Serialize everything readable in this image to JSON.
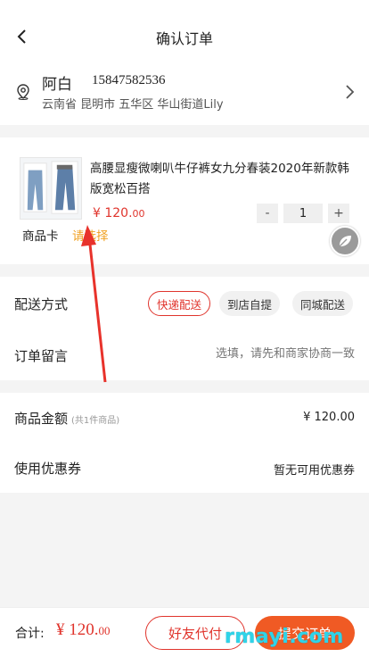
{
  "header": {
    "title": "确认订单"
  },
  "address": {
    "name": "阿白",
    "phone": "15847582536",
    "detail": "云南省 昆明市 五华区 华山街道Lily"
  },
  "product": {
    "title": "高腰显瘦微喇叭牛仔裤女九分春装2020年新款韩版宽松百搭",
    "price_main": "¥ 120.",
    "price_cents": "00",
    "qty_minus": "-",
    "qty_value": "1",
    "qty_plus": "+",
    "card_label": "商品卡",
    "card_select": "请选择"
  },
  "delivery": {
    "label": "配送方式",
    "options": [
      "快递配送",
      "到店自提",
      "同城配送"
    ],
    "selected": "快递配送"
  },
  "note": {
    "label": "订单留言",
    "placeholder": "选填，请先和商家协商一致"
  },
  "summary": {
    "goods_label": "商品金额",
    "goods_sub": "(共1件商品)",
    "goods_value": "¥ 120.00",
    "coupon_label": "使用优惠券",
    "coupon_value": "暂无可用优惠券"
  },
  "footer": {
    "total_label": "合计:",
    "total_main": "¥ 120.",
    "total_cents": "00",
    "friend_pay": "好友代付",
    "submit": "提交订单"
  },
  "watermark": "rmayi.com",
  "colors": {
    "accent_red": "#e0342c",
    "submit_orange": "#f05a24",
    "select_orange": "#f0a020"
  }
}
